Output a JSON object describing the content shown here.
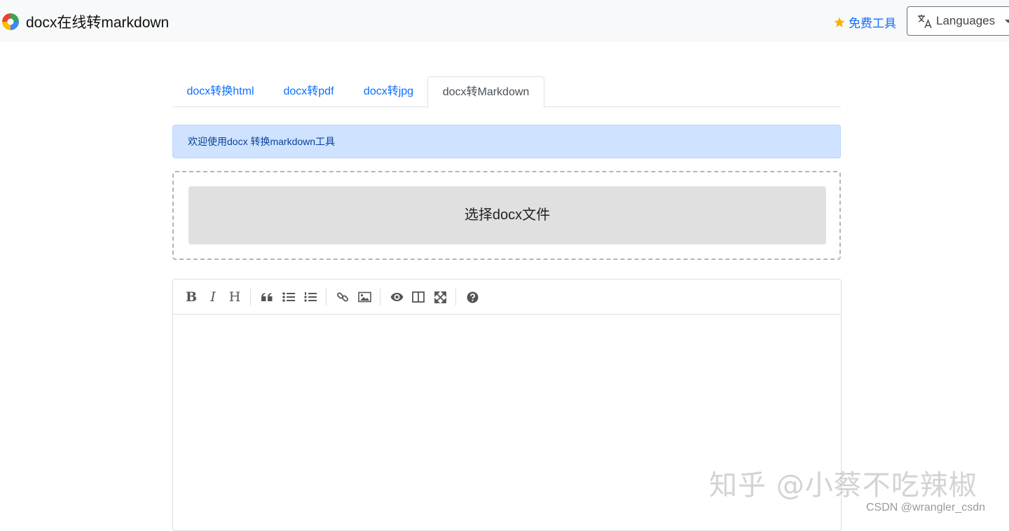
{
  "navbar": {
    "brand": "docx在线转markdown",
    "free_tools": "免费工具",
    "languages": "Languages"
  },
  "tabs": [
    {
      "label": "docx转换html",
      "active": false
    },
    {
      "label": "docx转pdf",
      "active": false
    },
    {
      "label": "docx转jpg",
      "active": false
    },
    {
      "label": "docx转Markdown",
      "active": true
    }
  ],
  "alert": {
    "text": "欢迎使用docx 转换markdown工具"
  },
  "upload": {
    "button_label": "选择docx文件"
  },
  "editor": {
    "toolbar": {
      "bold": "B",
      "italic": "I",
      "heading": "H"
    },
    "content": ""
  },
  "watermarks": {
    "zhihu": "知乎 @小蔡不吃辣椒",
    "csdn": "CSDN @wrangler_csdn"
  },
  "colors": {
    "link": "#0d6efd",
    "alert_bg": "#cfe2ff",
    "button_bg": "#e0e0e0",
    "star": "#f7b500"
  }
}
